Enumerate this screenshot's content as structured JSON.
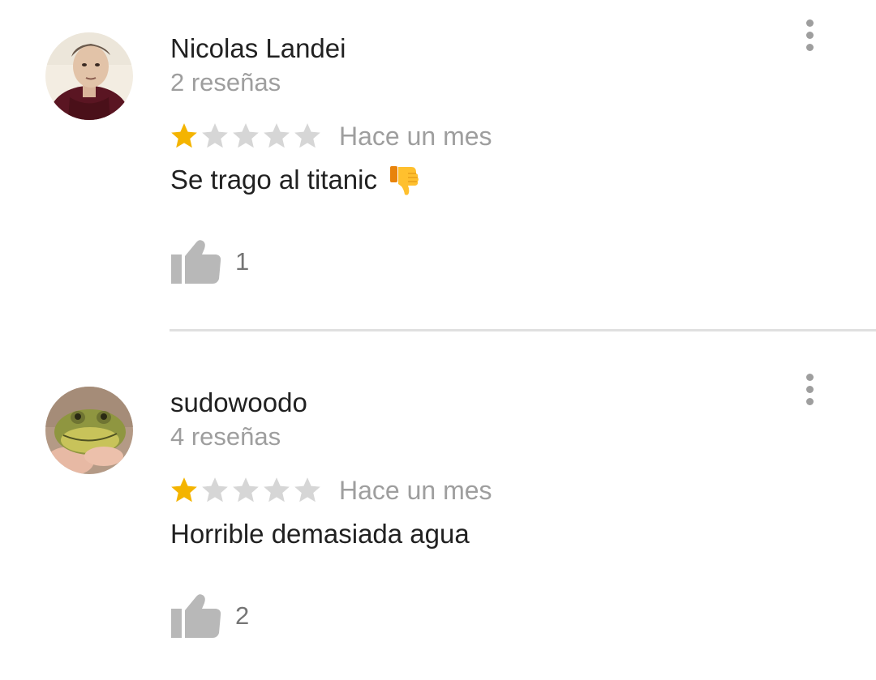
{
  "colors": {
    "star_filled": "#f4b400",
    "star_empty": "#d6d6d6",
    "text_primary": "#212121",
    "text_secondary": "#9e9e9e"
  },
  "reviews": [
    {
      "author": "Nicolas Landei",
      "review_count": "2 reseñas",
      "rating": 1,
      "max_rating": 5,
      "date": "Hace un mes",
      "text": "Se trago al titanic",
      "emoji": "thumbs-down-emoji",
      "likes": "1",
      "avatar_icon": "user-avatar-photo",
      "like_icon": "thumbs-up-icon",
      "menu_icon": "more-vert-icon"
    },
    {
      "author": "sudowoodo",
      "review_count": "4 reseñas",
      "rating": 1,
      "max_rating": 5,
      "date": "Hace un mes",
      "text": "Horrible demasiada agua",
      "likes": "2",
      "avatar_icon": "frog-avatar-photo",
      "like_icon": "thumbs-up-icon",
      "menu_icon": "more-vert-icon"
    }
  ]
}
